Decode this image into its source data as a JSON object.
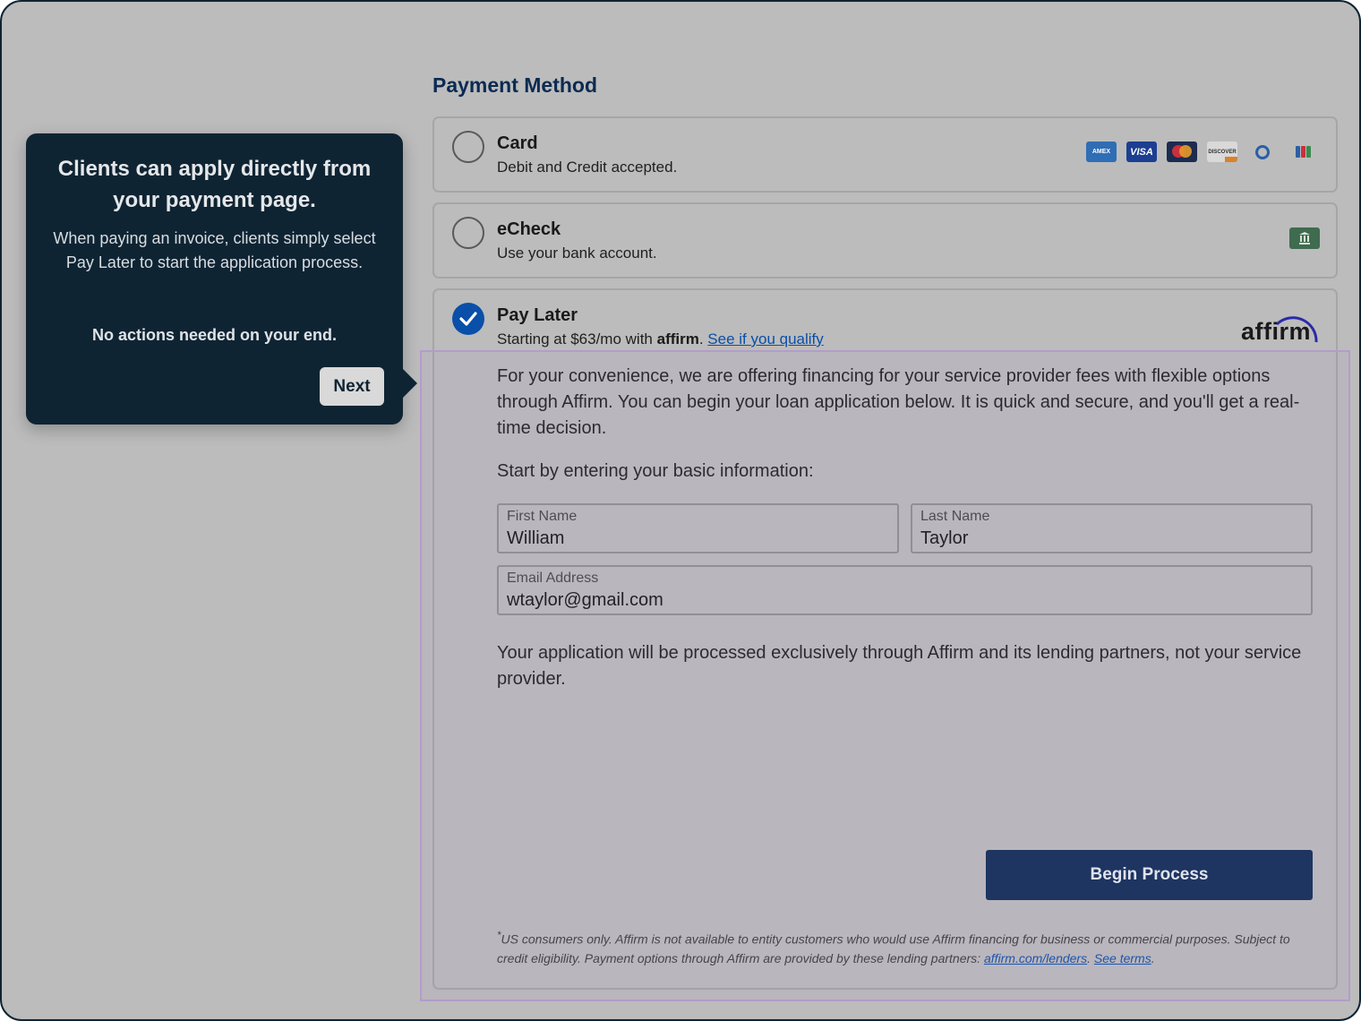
{
  "payment": {
    "section_title": "Payment Method",
    "options": [
      {
        "title": "Card",
        "subtitle": "Debit and Credit accepted.",
        "selected": false,
        "icons": [
          "amex-icon",
          "visa-icon",
          "mastercard-icon",
          "discover-icon",
          "diners-icon",
          "jcb-icon"
        ],
        "icon_labels": {
          "amex": "AMEX",
          "visa": "VISA",
          "discover": "DISCOVER"
        }
      },
      {
        "title": "eCheck",
        "subtitle": "Use your bank account.",
        "selected": false,
        "icon": "bank-icon"
      },
      {
        "title": "Pay Later",
        "subtitle_prefix": "Starting at $63/mo with",
        "affirm_inline": "affirm",
        "qualify_link": "See if you qualify",
        "selected": true,
        "logo_text": "affirm"
      }
    ]
  },
  "pay_later": {
    "intro": "For your convenience, we are offering financing for your service provider fees with flexible options through Affirm. You can begin your loan application below. It is quick and secure, and you'll get a real-time decision.",
    "start_prompt": "Start by entering your basic information:",
    "fields": {
      "first_name": {
        "label": "First Name",
        "value": "William"
      },
      "last_name": {
        "label": "Last Name",
        "value": "Taylor"
      },
      "email": {
        "label": "Email Address",
        "value": "wtaylor@gmail.com"
      }
    },
    "disclaimer": "Your application will be processed exclusively through Affirm and its lending partners, not your service provider.",
    "begin_button": "Begin Process",
    "footnote_text": "US consumers only. Affirm is not available to entity customers who would use Affirm financing for business or commercial purposes. Subject to credit eligibility. Payment options through Affirm are provided by these lending partners:",
    "footnote_link_lenders": "affirm.com/lenders",
    "footnote_link_terms": "See terms"
  },
  "tooltip": {
    "title": "Clients can apply directly from your payment page.",
    "body": "When paying an invoice, clients simply select Pay Later to start the application process.",
    "note": "No actions needed on your end.",
    "next_button": "Next"
  },
  "colors": {
    "overlay": "#bcbcbc",
    "tooltip_bg": "#0f2433",
    "accent": "#0a4fa8",
    "primary_button": "#0a2a52",
    "highlight": "#b39ccb"
  }
}
